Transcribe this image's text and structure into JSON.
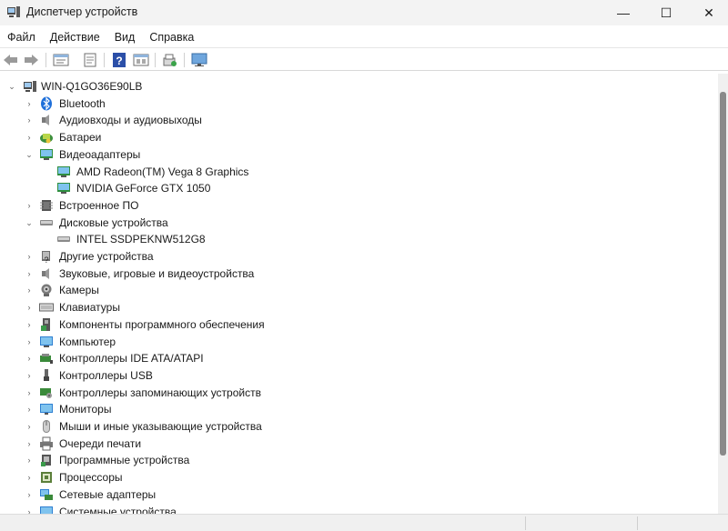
{
  "window": {
    "title": "Диспетчер устройств",
    "minimize_glyph": "—",
    "maximize_glyph": "☐",
    "close_glyph": "✕"
  },
  "menu": [
    "Файл",
    "Действие",
    "Вид",
    "Справка"
  ],
  "toolbar": {
    "buttons": [
      "back-icon",
      "forward-icon",
      "properties-icon",
      "update-driver-icon",
      "help-icon",
      "show-hidden-icon",
      "scan-hardware-icon",
      "monitor-icon"
    ]
  },
  "tree": {
    "root": "WIN-Q1GO36E90LB",
    "items": [
      {
        "label": "Bluetooth",
        "icon": "bluetooth-icon",
        "state": "collapsed"
      },
      {
        "label": "Аудиовходы и аудиовыходы",
        "icon": "speaker-icon",
        "state": "collapsed"
      },
      {
        "label": "Батареи",
        "icon": "battery-icon",
        "state": "collapsed"
      },
      {
        "label": "Видеоадаптеры",
        "icon": "display-adapter-icon",
        "state": "expanded",
        "children": [
          "AMD Radeon(TM) Vega 8 Graphics",
          "NVIDIA GeForce GTX 1050"
        ]
      },
      {
        "label": "Встроенное ПО",
        "icon": "firmware-icon",
        "state": "collapsed"
      },
      {
        "label": "Дисковые устройства",
        "icon": "disk-icon",
        "state": "expanded",
        "children": [
          "INTEL SSDPEKNW512G8"
        ]
      },
      {
        "label": "Другие устройства",
        "icon": "unknown-device-icon",
        "state": "collapsed"
      },
      {
        "label": "Звуковые, игровые и видеоустройства",
        "icon": "sound-icon",
        "state": "collapsed"
      },
      {
        "label": "Камеры",
        "icon": "camera-icon",
        "state": "collapsed"
      },
      {
        "label": "Клавиатуры",
        "icon": "keyboard-icon",
        "state": "collapsed"
      },
      {
        "label": "Компоненты программного обеспечения",
        "icon": "software-component-icon",
        "state": "collapsed"
      },
      {
        "label": "Компьютер",
        "icon": "computer-icon",
        "state": "collapsed"
      },
      {
        "label": "Контроллеры IDE ATA/ATAPI",
        "icon": "ide-controller-icon",
        "state": "collapsed"
      },
      {
        "label": "Контроллеры USB",
        "icon": "usb-icon",
        "state": "collapsed"
      },
      {
        "label": "Контроллеры запоминающих устройств",
        "icon": "storage-controller-icon",
        "state": "collapsed"
      },
      {
        "label": "Мониторы",
        "icon": "monitor-icon",
        "state": "collapsed"
      },
      {
        "label": "Мыши и иные указывающие устройства",
        "icon": "mouse-icon",
        "state": "collapsed"
      },
      {
        "label": "Очереди печати",
        "icon": "printer-icon",
        "state": "collapsed"
      },
      {
        "label": "Программные устройства",
        "icon": "software-device-icon",
        "state": "collapsed"
      },
      {
        "label": "Процессоры",
        "icon": "processor-icon",
        "state": "collapsed"
      },
      {
        "label": "Сетевые адаптеры",
        "icon": "network-adapter-icon",
        "state": "collapsed"
      },
      {
        "label": "Системные устройства",
        "icon": "system-device-icon",
        "state": "collapsed"
      }
    ]
  }
}
